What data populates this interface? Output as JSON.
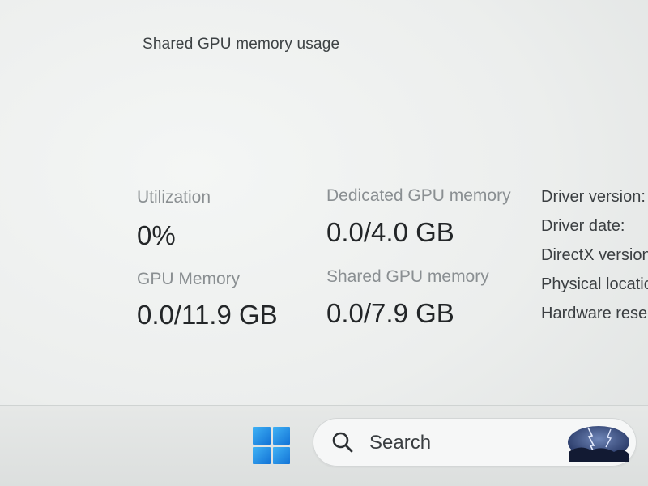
{
  "chart_header": {
    "label": "Shared GPU memory usage"
  },
  "stats": [
    {
      "label": "Utilization",
      "value": "0%"
    },
    {
      "label": "Dedicated GPU memory",
      "value": "0.0/4.0 GB"
    },
    {
      "label": "GPU Memory",
      "value": "0.0/11.9 GB"
    },
    {
      "label": "Shared GPU memory",
      "value": "0.0/7.9 GB"
    }
  ],
  "info": [
    "Driver version:",
    "Driver date:",
    "DirectX version:",
    "Physical location:",
    "Hardware reserved memory:"
  ],
  "taskbar": {
    "search_label": "Search",
    "start_icon": "windows-logo-icon",
    "search_icon": "magnifier-icon",
    "widget_icon": "storm-image"
  },
  "colors": {
    "start_blue": "#1d8ae6",
    "background": "#eceeed"
  }
}
